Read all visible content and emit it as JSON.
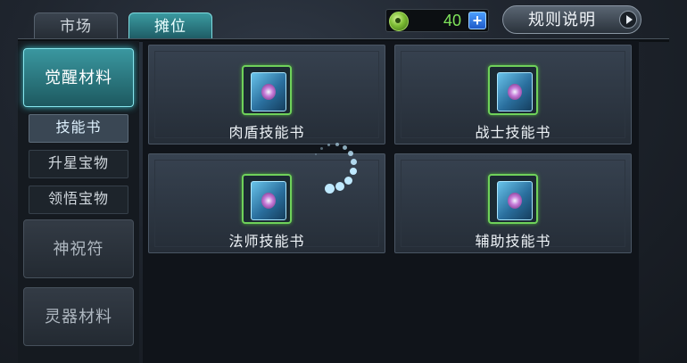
{
  "tabs": [
    {
      "label": "市场",
      "active": false
    },
    {
      "label": "摊位",
      "active": true
    }
  ],
  "currency": {
    "icon": "jade-coin-icon",
    "value": "40",
    "add_icon": "plus-icon"
  },
  "rules_button": {
    "label": "规则说明",
    "icon": "play-arrow-icon"
  },
  "sidebar": {
    "categories": [
      {
        "label": "觉醒材料",
        "active": true
      },
      {
        "label": "神祝符",
        "active": false
      },
      {
        "label": "灵器材料",
        "active": false
      }
    ],
    "subitems": [
      {
        "label": "技能书",
        "active": true
      },
      {
        "label": "升星宝物",
        "active": false
      },
      {
        "label": "领悟宝物",
        "active": false
      }
    ]
  },
  "items": [
    {
      "name": "肉盾技能书",
      "icon": "skill-book-icon"
    },
    {
      "name": "战士技能书",
      "icon": "skill-book-icon"
    },
    {
      "name": "法师技能书",
      "icon": "skill-book-icon"
    },
    {
      "name": "辅助技能书",
      "icon": "skill-book-icon"
    }
  ],
  "loading_indicator": {
    "icon": "loading-spinner-icon"
  },
  "colors": {
    "accent_teal": "#3a97a0",
    "currency_green": "#7fe35a",
    "item_frame_green": "#6fd15a",
    "plus_blue": "#2f7be0"
  }
}
